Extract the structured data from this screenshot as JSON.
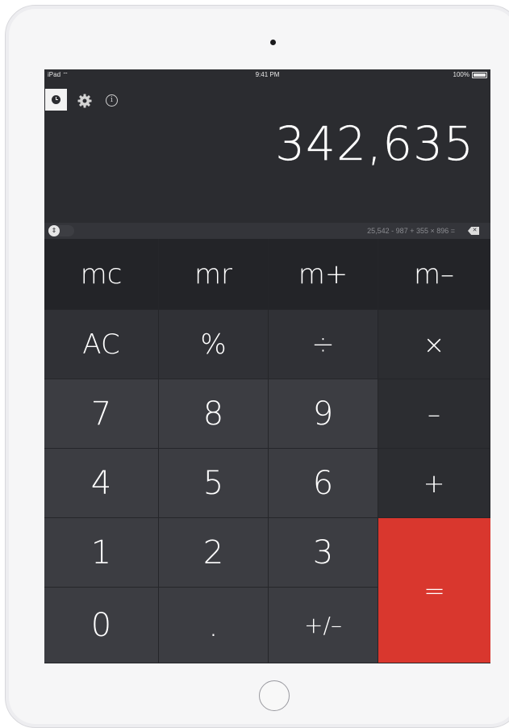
{
  "status_bar": {
    "carrier": "iPad",
    "time": "9:41 PM",
    "battery": "100%"
  },
  "display": {
    "value": "342,635"
  },
  "tape": {
    "expression": "25,542 - 987 + 355 × 896 ="
  },
  "keys": {
    "mc": "mc",
    "mr": "mr",
    "m_plus": "m+",
    "m_minus": "m–",
    "ac": "AC",
    "percent": "%",
    "divide": "÷",
    "multiply": "×",
    "seven": "7",
    "eight": "8",
    "nine": "9",
    "minus": "–",
    "four": "4",
    "five": "5",
    "six": "6",
    "plus": "+",
    "one": "1",
    "two": "2",
    "three": "3",
    "equals": "=",
    "zero": "0",
    "decimal": ".",
    "sign": "+/–"
  },
  "icons": {
    "history": "clock-icon",
    "settings": "gear-icon",
    "info": "info-icon",
    "tape_toggle": "toggle-icon",
    "delete": "backspace-icon"
  },
  "colors": {
    "equals_accent": "#d9372e",
    "background": "#2b2c30"
  }
}
